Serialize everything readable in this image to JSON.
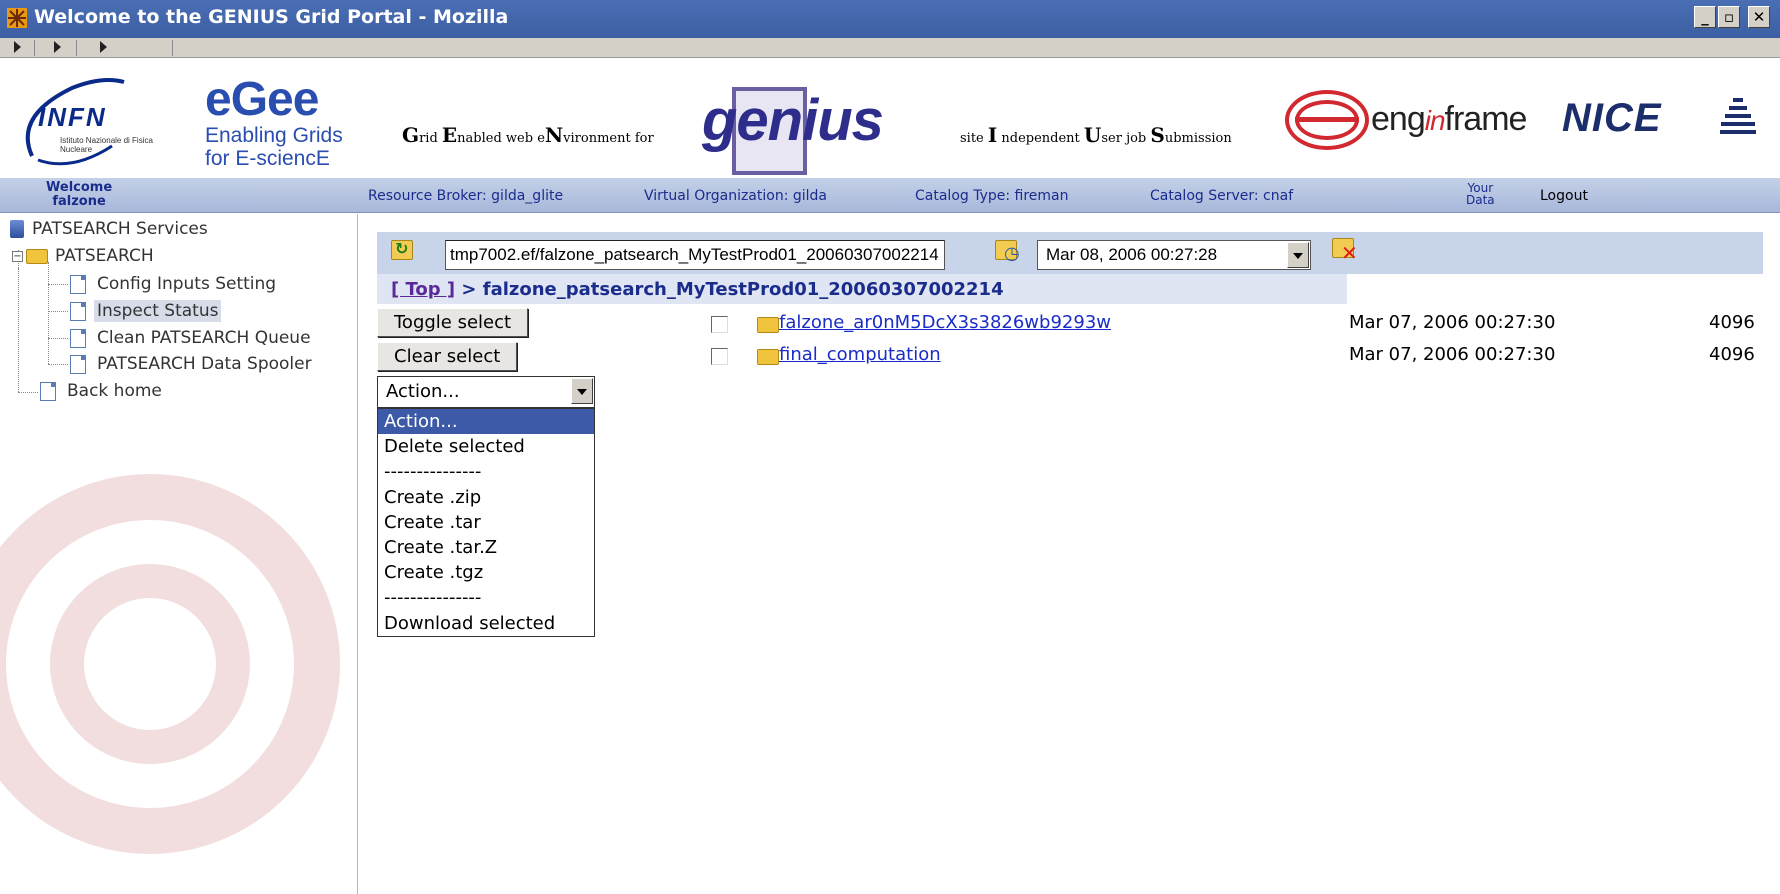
{
  "window": {
    "title": "Welcome to the GENIUS Grid Portal - Mozilla",
    "controls": [
      "_",
      "▫",
      "✕"
    ]
  },
  "logos": {
    "infn": {
      "name": "INFN",
      "subtitle": "Istituto Nazionale di Fisica Nucleare"
    },
    "egee": {
      "name": "eGee",
      "line1": "Enabling Grids",
      "line2": "for E-sciencE"
    },
    "grid_env": {
      "G": "G",
      "t1": "rid ",
      "E": "E",
      "t2": "nabled web e",
      "N": "N",
      "t3": "vironment for"
    },
    "genius": "genius",
    "site_ind": {
      "t0": "site ",
      "I": "I",
      "t1": " ndependent ",
      "U": "U",
      "t2": "ser job ",
      "S": "S",
      "t3": "ubmission"
    },
    "enginframe": {
      "pre": "eng",
      "mid": "in",
      "post": "frame"
    },
    "nice": "NICE"
  },
  "infobar": {
    "welcome_line1": "Welcome",
    "welcome_line2": "falzone",
    "resource_broker": "Resource Broker: gilda_glite",
    "virtual_org": "Virtual Organization: gilda",
    "catalog_type": "Catalog Type: fireman",
    "catalog_server": "Catalog Server: cnaf",
    "your_data_line1": "Your",
    "your_data_line2": "Data",
    "logout": "Logout"
  },
  "sidebar": {
    "services_title": "PATSEARCH Services",
    "folder": "PATSEARCH",
    "items": [
      {
        "label": "Config Inputs Setting"
      },
      {
        "label": "Inspect Status"
      },
      {
        "label": "Clean PATSEARCH Queue"
      },
      {
        "label": "PATSEARCH Data Spooler"
      }
    ],
    "back_home": "Back home"
  },
  "main": {
    "path_value": "tmp7002.ef/falzone_patsearch_MyTestProd01_20060307002214",
    "date_value": "Mar 08, 2006 00:27:28",
    "breadcrumb_top": "[ Top ]",
    "breadcrumb_sep": " > ",
    "breadcrumb_current": "falzone_patsearch_MyTestProd01_20060307002214",
    "toggle_select": "Toggle select",
    "clear_select": "Clear select",
    "action_selected": "Action...",
    "action_options": [
      "Action...",
      "Delete selected",
      "---------------",
      "Create .zip",
      "Create .tar",
      "Create .tar.Z",
      "Create .tgz",
      "---------------",
      "Download selected"
    ],
    "files": [
      {
        "name": "falzone_ar0nM5DcX3s3826wb9293w",
        "date": "Mar 07, 2006 00:27:30",
        "size": "4096"
      },
      {
        "name": "final_computation",
        "date": "Mar 07, 2006 00:27:30",
        "size": "4096"
      }
    ]
  }
}
